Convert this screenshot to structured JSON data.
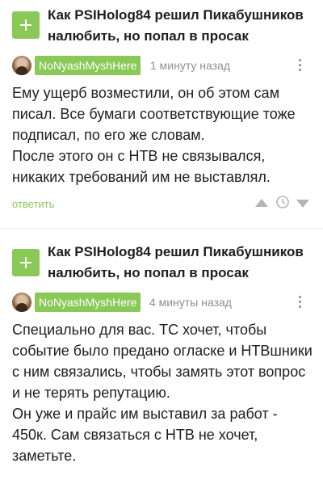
{
  "posts": [
    {
      "title": "Как PSIHolog84 решил Пикабушников налюбить, но попал в просак",
      "comment": {
        "username": "NoNyashMyshHere",
        "time": "1 минуту назад",
        "paragraphs": [
          "Ему ущерб возместили, он об этом сам писал. Все бумаги соответствующие тоже подписал, по его же словам.",
          "После этого он с НТВ не связывался, никаких требований им не выставлял."
        ],
        "reply_label": "ответить"
      }
    },
    {
      "title": "Как PSIHolog84 решил Пикабушников налюбить, но попал в просак",
      "comment": {
        "username": "NoNyashMyshHere",
        "time": "4 минуты назад",
        "paragraphs": [
          "Специально для вас. ТС хочет, чтобы событие было предано огласке и НТВшники с ним связались, чтобы замять этот вопрос и не терять репутацию.",
          "Он уже и прайс им выставил за работ - 450к. Сам связаться с НТВ не хочет, заметьте."
        ]
      }
    }
  ],
  "icons": {
    "plus": "plus-icon",
    "more": "more-vertical-icon",
    "upvote": "arrow-up-icon",
    "downvote": "arrow-down-icon",
    "time": "clock-icon"
  },
  "colors": {
    "accent": "#8ac858",
    "text": "#1e1e1e",
    "muted": "#8f8f8f"
  }
}
